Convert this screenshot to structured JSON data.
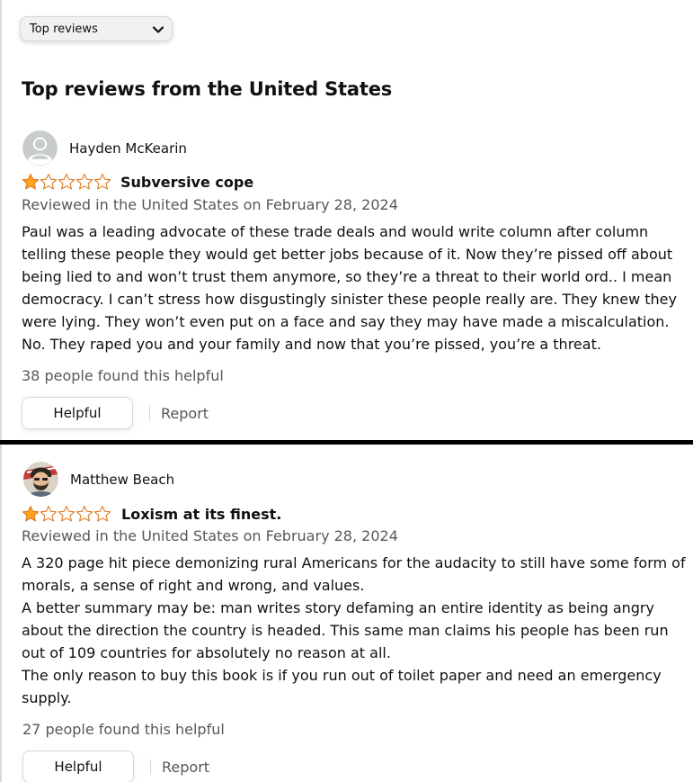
{
  "sort": {
    "label": "Top reviews"
  },
  "section_title": "Top reviews from the United States",
  "reviews": [
    {
      "author": "Hayden McKearin",
      "rating": 1,
      "title": "Subversive cope",
      "date_line": "Reviewed in the United States on February 28, 2024",
      "body": [
        "Paul was a leading advocate of these trade deals and would write column after column telling these people they would get better jobs because of it. Now they’re pissed off about being lied to and won’t trust them anymore, so they’re a threat to their world ord.. I mean democracy. I can’t stress how disgustingly sinister these people really are. They knew they were lying. They won’t even put on a face and say they may have made a miscalculation. No. They raped you and your family and now that you’re pissed, you’re a threat."
      ],
      "helpful_count": "38 people found this helpful",
      "helpful_label": "Helpful",
      "report_label": "Report"
    },
    {
      "author": "Matthew Beach",
      "rating": 1,
      "title": "Loxism at its finest.",
      "date_line": "Reviewed in the United States on February 28, 2024",
      "body": [
        "A 320 page hit piece demonizing rural Americans for the audacity to still have some form of morals, a sense of right and wrong, and values.",
        "A better summary may be: man writes story defaming an entire identity as being angry about the direction the country is headed. This same man claims his people has been run out of 109 countries for absolutely no reason at all.",
        "The only reason to buy this book is if you run out of toilet paper and need an emergency supply."
      ],
      "helpful_count": "27 people found this helpful",
      "helpful_label": "Helpful",
      "report_label": "Report"
    }
  ],
  "colors": {
    "star_fill": "#ffa41c",
    "star_outline": "#de7921",
    "secondary_text": "#565959"
  },
  "icons": {
    "sort_chevron": "chevron-down-icon",
    "avatar_default": "default-avatar-icon",
    "avatar_custom": "profile-avatar-icon",
    "star": "star-icon"
  }
}
